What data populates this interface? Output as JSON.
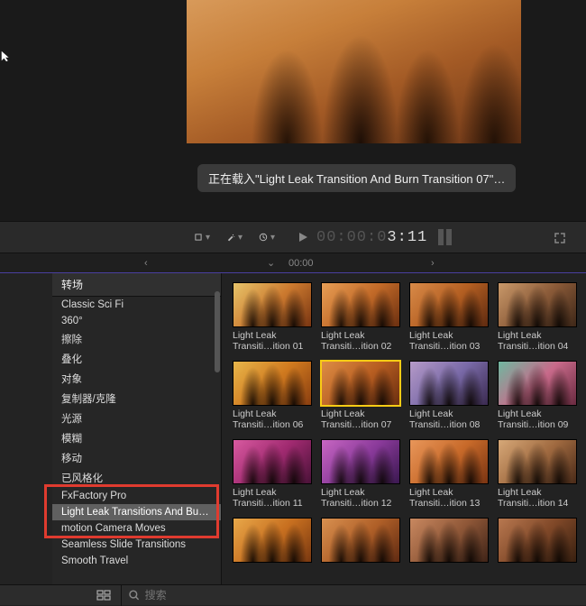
{
  "viewer": {
    "loading_text": "正在载入\"Light Leak Transition And Burn Transition 07\"…",
    "timecode_dim": "00:00:0",
    "timecode_bright": "3:11"
  },
  "ruler": {
    "center_label": "00:00"
  },
  "sidebar": {
    "header": "转场",
    "items": [
      {
        "label": "Classic Sci Fi",
        "selected": false
      },
      {
        "label": "360°",
        "selected": false
      },
      {
        "label": "擦除",
        "selected": false
      },
      {
        "label": "叠化",
        "selected": false
      },
      {
        "label": "对象",
        "selected": false
      },
      {
        "label": "复制器/克隆",
        "selected": false
      },
      {
        "label": "光源",
        "selected": false
      },
      {
        "label": "模糊",
        "selected": false
      },
      {
        "label": "移动",
        "selected": false
      },
      {
        "label": "已风格化",
        "selected": false
      },
      {
        "label": "FxFactory Pro",
        "selected": false
      },
      {
        "label": "Light Leak Transitions And Burn…",
        "selected": true
      },
      {
        "label": "motion Camera Moves",
        "selected": false
      },
      {
        "label": "Seamless Slide Transitions",
        "selected": false
      },
      {
        "label": "Smooth Travel",
        "selected": false
      }
    ]
  },
  "grid": {
    "items": [
      {
        "name": "Light Leak",
        "sub": "Transiti…ition 01",
        "bg": "linear-gradient(135deg,#e7c46a,#cc7a2f,#7a3612)",
        "sel": false
      },
      {
        "name": "Light Leak",
        "sub": "Transiti…ition 02",
        "bg": "linear-gradient(135deg,#e79e55,#c26a28,#6b2f10)",
        "sel": false
      },
      {
        "name": "Light Leak",
        "sub": "Transiti…ition 03",
        "bg": "linear-gradient(135deg,#d88a48,#b45f22,#5e2a10)",
        "sel": false
      },
      {
        "name": "Light Leak",
        "sub": "Transiti…ition 04",
        "bg": "linear-gradient(135deg,#c9996a,#8a5a38,#3e2718)",
        "sel": false
      },
      {
        "name": "Light Leak",
        "sub": "Transiti…ition 06",
        "bg": "linear-gradient(135deg,#e8b64b,#d07a1f,#8a3e10)",
        "sel": false
      },
      {
        "name": "Light Leak",
        "sub": "Transiti…ition 07",
        "bg": "linear-gradient(135deg,#dd8d45,#b85e21,#6a2e10)",
        "sel": true
      },
      {
        "name": "Light Leak",
        "sub": "Transiti…ition 08",
        "bg": "linear-gradient(135deg,#b59ac8,#7a6aa8,#3a2a50)",
        "sel": false
      },
      {
        "name": "Light Leak",
        "sub": "Transiti…ition 09",
        "bg": "linear-gradient(135deg,#6fb8a0,#c86a8a,#6a2a40)",
        "sel": false
      },
      {
        "name": "Light Leak",
        "sub": "Transiti…ition 11",
        "bg": "linear-gradient(135deg,#d85aa0,#a02a70,#4a1238)",
        "sel": false
      },
      {
        "name": "Light Leak",
        "sub": "Transiti…ition 12",
        "bg": "linear-gradient(135deg,#c766c2,#8a3a9a,#3a1850)",
        "sel": false
      },
      {
        "name": "Light Leak",
        "sub": "Transiti…ition 13",
        "bg": "linear-gradient(135deg,#e8965a,#c86a2a,#7a3412)",
        "sel": false
      },
      {
        "name": "Light Leak",
        "sub": "Transiti…ition 14",
        "bg": "linear-gradient(135deg,#d6a878,#a06a40,#4a2a18)",
        "sel": false
      },
      {
        "name": "",
        "sub": "",
        "bg": "linear-gradient(135deg,#e8a84a,#c87020,#7a3810)",
        "sel": false
      },
      {
        "name": "",
        "sub": "",
        "bg": "linear-gradient(135deg,#d89050,#b06028,#602a12)",
        "sel": false
      },
      {
        "name": "",
        "sub": "",
        "bg": "linear-gradient(135deg,#c88860,#905838,#402418)",
        "sel": false
      },
      {
        "name": "",
        "sub": "",
        "bg": "linear-gradient(135deg,#b87850,#804828,#382010)",
        "sel": false
      }
    ]
  },
  "search": {
    "placeholder": "搜索"
  }
}
